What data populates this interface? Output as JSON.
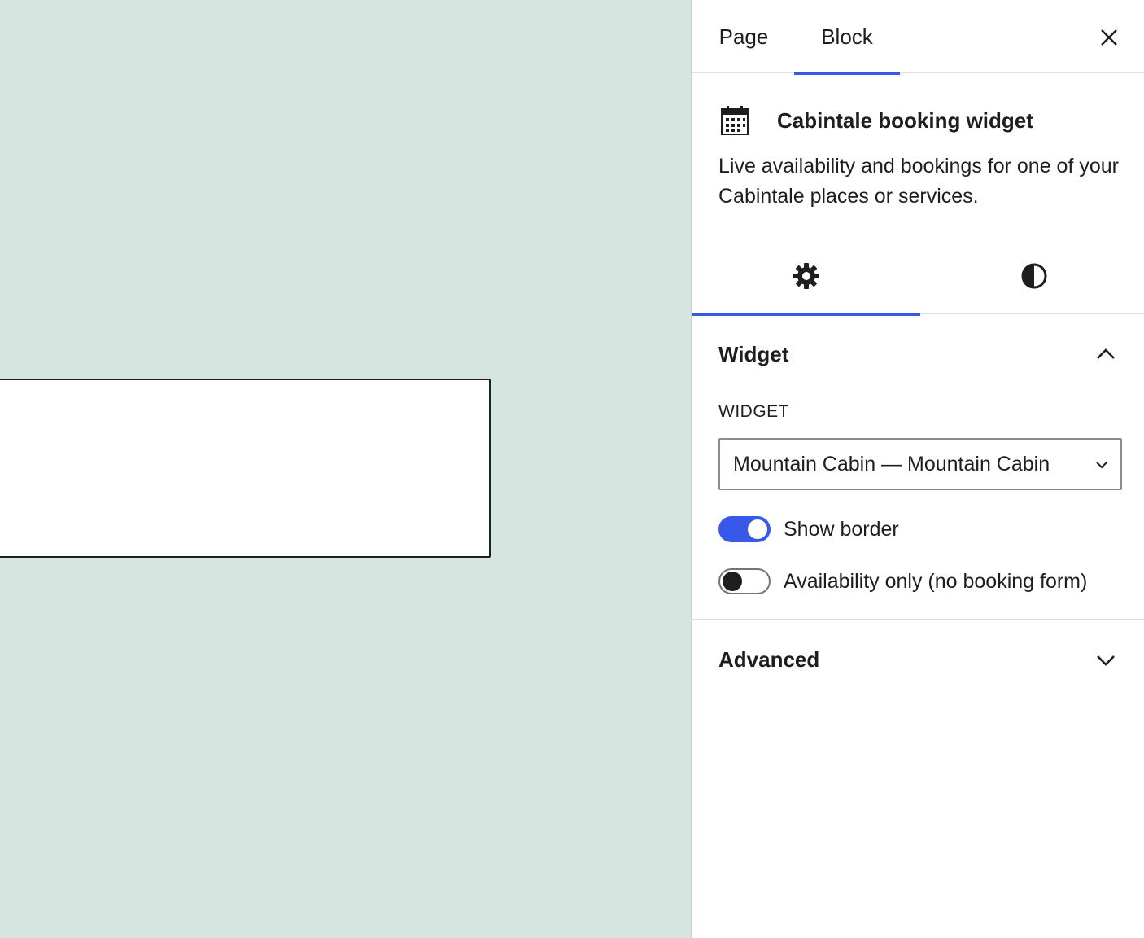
{
  "sidebar": {
    "tabs": [
      {
        "label": "Page",
        "active": false
      },
      {
        "label": "Block",
        "active": true
      }
    ],
    "close_icon": "close-icon",
    "block": {
      "icon": "calendar-icon",
      "title": "Cabintale booking widget",
      "description": "Live availability and bookings for one of your Cabintale places or services."
    },
    "inspector_tabs": [
      {
        "icon": "gear-icon",
        "active": true
      },
      {
        "icon": "contrast-icon",
        "active": false
      }
    ],
    "panels": {
      "widget": {
        "title": "Widget",
        "expanded": true,
        "field_label": "Widget",
        "select_value": "Mountain Cabin — Mountain Cabin",
        "toggles": [
          {
            "label": "Show border",
            "on": true
          },
          {
            "label": "Availability only (no booking form)",
            "on": false
          }
        ]
      },
      "advanced": {
        "title": "Advanced",
        "expanded": false
      }
    }
  },
  "colors": {
    "canvas_bg": "#d5e5df",
    "accent": "#3858e9",
    "text": "#1e1e1e"
  }
}
